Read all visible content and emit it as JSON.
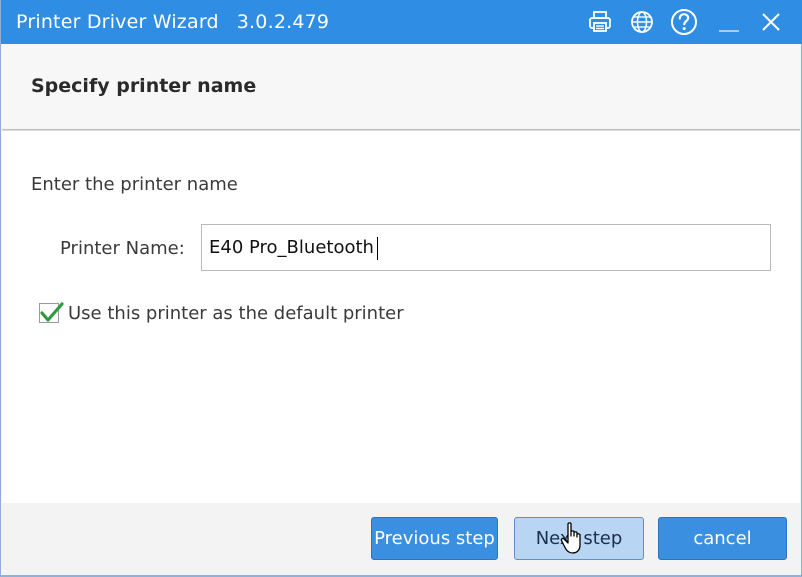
{
  "window": {
    "title": "Printer Driver Wizard",
    "version": "3.0.2.479",
    "accent_color": "#2f8ee4",
    "title_icons": [
      "printer-icon",
      "globe-icon",
      "help-icon",
      "minimize-icon",
      "close-icon"
    ]
  },
  "header": {
    "title": "Specify printer name"
  },
  "form": {
    "instruction": "Enter the printer name",
    "printer_name_label": "Printer Name:",
    "printer_name_value": "E40 Pro_Bluetooth",
    "default_checkbox_label": "Use this printer as the default printer",
    "default_checked": true
  },
  "footer": {
    "previous_label": "Previous step",
    "next_label": "Next step",
    "cancel_label": "cancel"
  }
}
